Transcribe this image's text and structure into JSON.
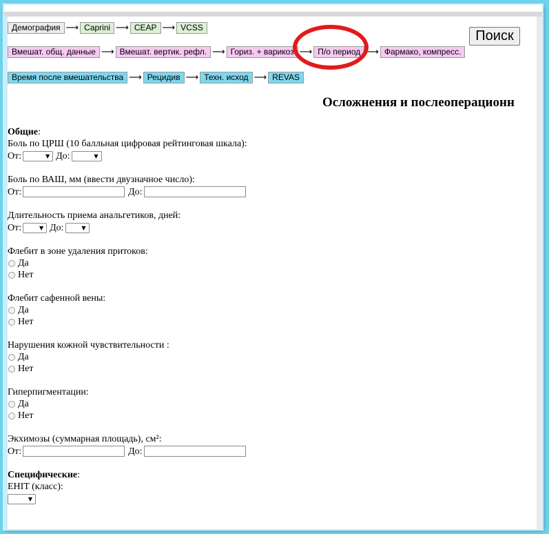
{
  "nav": {
    "row1": [
      "Демография",
      "Caprini",
      "CEAP",
      "VCSS"
    ],
    "row2": [
      "Вмешат. общ. данные",
      "Вмешат. вертик. рефл.",
      "Гориз. + варикоз",
      "П/о период",
      "Фармако, компресс."
    ],
    "row3": [
      "Время после вмешательства",
      "Рецидив",
      "Техн. исход",
      "REVAS"
    ],
    "arrow": "⟶"
  },
  "search_label": "Поиск",
  "page_title": "Осложнения и послеоперационн",
  "colors": {
    "highlight_ring": "#e11a1a",
    "tab_green": "#dbf0d4",
    "tab_pink": "#f6c8f2",
    "tab_blue": "#7fd7ee"
  },
  "form": {
    "general_head": "Общие",
    "colon": ":",
    "from": "От:",
    "to": "До:",
    "pain_nrs": "Боль по ЦРШ (10 балльная цифровая рейтинговая шкала):",
    "pain_vas": "Боль по ВАШ, мм (ввести двузначное число):",
    "analgesics": "Длительность приема анальгетиков, дней:",
    "phlebitis_tributaries": "Флебит в зоне удаления притоков:",
    "phlebitis_saphenous": "Флебит сафенной вены:",
    "skin_sensitivity": "Нарушения кожной чувствительности :",
    "hyperpigmentation": "Гиперпигментации:",
    "ecchymosis": "Экхимозы (суммарная площадь), см²:",
    "yes": "Да",
    "no": "Нет",
    "specific_head": "Специфические",
    "ehit": "EHIT (класс):"
  }
}
